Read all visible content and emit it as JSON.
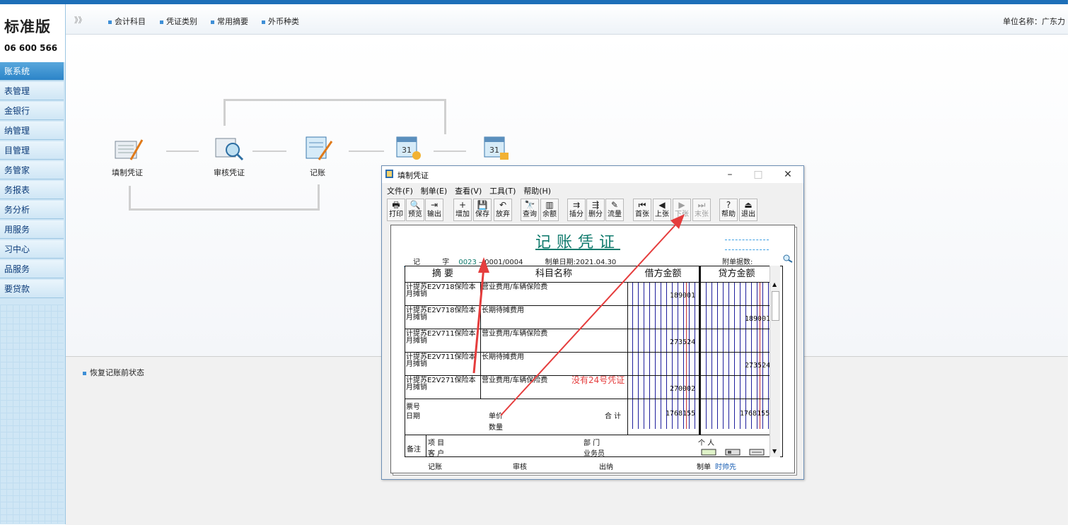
{
  "brand": {
    "title": "标准版",
    "phone": "06 600 566"
  },
  "sidebar": {
    "items": [
      {
        "label": "账系统",
        "active": true
      },
      {
        "label": "表管理"
      },
      {
        "label": "金银行"
      },
      {
        "label": "纳管理"
      },
      {
        "label": "目管理"
      },
      {
        "label": "务管家"
      },
      {
        "label": "务报表"
      },
      {
        "label": "务分析"
      },
      {
        "label": "用服务"
      },
      {
        "label": "习中心"
      },
      {
        "label": "品服务"
      },
      {
        "label": "要贷款"
      }
    ]
  },
  "toolbar": {
    "chevron": "》》",
    "links": [
      "会计科目",
      "凭证类别",
      "常用摘要",
      "外币种类"
    ],
    "unit_label": "单位名称：广东力"
  },
  "flow": {
    "steps": [
      {
        "label": "填制凭证",
        "icon": "voucher-fill-icon"
      },
      {
        "label": "审核凭证",
        "icon": "voucher-audit-icon"
      },
      {
        "label": "记账",
        "icon": "posting-icon"
      },
      {
        "label": "",
        "icon": "calendar-close-icon"
      },
      {
        "label": "",
        "icon": "calendar-lock-icon"
      }
    ]
  },
  "lower": {
    "restore_link": "恢复记账前状态"
  },
  "dialog": {
    "title": "填制凭证",
    "controls": {
      "minimize": "–",
      "maximize": "□",
      "close": "✕"
    },
    "menu": [
      "文件(F)",
      "制单(E)",
      "查看(V)",
      "工具(T)",
      "帮助(H)"
    ],
    "tools": [
      {
        "label": "打印",
        "glyph": "🖶"
      },
      {
        "label": "预览",
        "glyph": "🔍"
      },
      {
        "label": "输出",
        "glyph": "⇥"
      },
      {
        "label": "增加",
        "glyph": "+"
      },
      {
        "label": "保存",
        "glyph": "💾"
      },
      {
        "label": "放弃",
        "glyph": "↶"
      },
      {
        "label": "查询",
        "glyph": "🔭"
      },
      {
        "label": "余额",
        "glyph": "▥"
      },
      {
        "label": "插分",
        "glyph": "⇉"
      },
      {
        "label": "删分",
        "glyph": "⇶"
      },
      {
        "label": "流量",
        "glyph": "✎"
      },
      {
        "label": "首张",
        "glyph": "⏮"
      },
      {
        "label": "上张",
        "glyph": "◀"
      },
      {
        "label": "下张",
        "glyph": "▶",
        "disabled": true
      },
      {
        "label": "末张",
        "glyph": "⏭",
        "disabled": true
      },
      {
        "label": "帮助",
        "glyph": "?"
      },
      {
        "label": "退出",
        "glyph": "⏏"
      }
    ],
    "voucher": {
      "title": "记账凭证",
      "type_char": "记",
      "zi": "字",
      "number": "0023",
      "sub_number": "– 0001/0004",
      "date_label": "制单日期:",
      "date_value": "2021.04.30",
      "attach_label": "附单据数:",
      "headers": {
        "summary": "摘 要",
        "account": "科目名称",
        "debit": "借方金额",
        "credit": "贷方金额"
      },
      "rows": [
        {
          "summary1": "计提苏E2V718保险本",
          "summary2": "月摊销",
          "account": "营业费用/车辆保险费",
          "debit": "189001",
          "credit": ""
        },
        {
          "summary1": "计提苏E2V718保险本",
          "summary2": "月摊销",
          "account": "长期待摊费用",
          "debit": "",
          "credit": "189001"
        },
        {
          "summary1": "计提苏E2V711保险本",
          "summary2": "月摊销",
          "account": "营业费用/车辆保险费",
          "debit": "273524",
          "credit": ""
        },
        {
          "summary1": "计提苏E2V711保险本",
          "summary2": "月摊销",
          "account": "长期待摊费用",
          "debit": "",
          "credit": "273524"
        },
        {
          "summary1": "计提苏E2V271保险本",
          "summary2": "月摊销",
          "account": "营业费用/车辆保险费",
          "debit": "270002",
          "credit": ""
        }
      ],
      "footer": {
        "ticket": "票号",
        "date": "日期",
        "unit_price": "单价",
        "qty": "数量",
        "total_label": "合 计",
        "total_debit": "1768155",
        "total_credit": "1768155",
        "remark": "备注",
        "project": "项 目",
        "dept": "部 门",
        "person": "个 人",
        "customer": "客 户",
        "salesman": "业务员"
      },
      "sign": {
        "post": "记账",
        "audit": "审核",
        "cashier": "出纳",
        "maker": "制单",
        "maker_name": "时帅先"
      }
    },
    "annotation": "没有24号凭证"
  }
}
